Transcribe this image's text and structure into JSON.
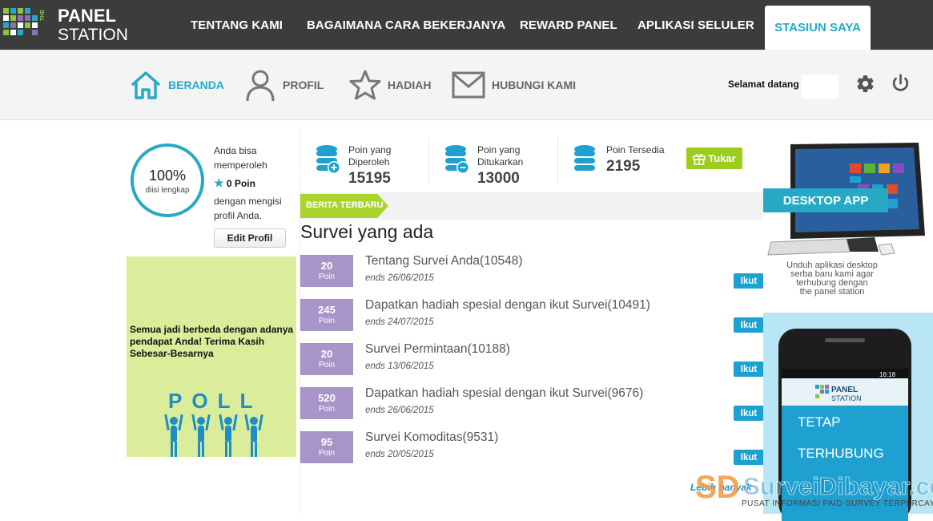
{
  "logo": {
    "the": "THE",
    "panel": "PANEL",
    "station": "STATION"
  },
  "topnav": {
    "items": [
      {
        "label": "TENTANG KAMI"
      },
      {
        "label": "BAGAIMANA CARA BEKERJANYA"
      },
      {
        "label": "REWARD PANEL"
      },
      {
        "label": "APLIKASI SELULER"
      }
    ],
    "active": "STASIUN SAYA"
  },
  "subnav": {
    "items": [
      {
        "label": "BERANDA",
        "icon": "home-icon"
      },
      {
        "label": "PROFIL",
        "icon": "user-icon"
      },
      {
        "label": "HADIAH",
        "icon": "star-icon"
      },
      {
        "label": "HUBUNGI KAMI",
        "icon": "mail-icon"
      }
    ],
    "welcome": "Selamat datang"
  },
  "profile": {
    "percent": "100%",
    "percent_caption": "diisi lengkap",
    "line1": "Anda bisa",
    "line2": "memperoleh",
    "points": "0 Poin",
    "line3": "dengan mengisi",
    "line4": "profil Anda.",
    "edit_button": "Edit Profil",
    "completion": 1.0
  },
  "poll": {
    "text": "Semua jadi berbeda dengan adanya pendapat Anda! Terima Kasih Sebesar-Besarnya",
    "word": "POLL"
  },
  "stats": [
    {
      "label_1": "Poin yang",
      "label_2": "Diperoleh",
      "value": "15195"
    },
    {
      "label_1": "Poin yang",
      "label_2": "Ditukarkan",
      "value": "13000"
    },
    {
      "label_1": "Poin Tersedia",
      "label_2": "",
      "value": "2195"
    }
  ],
  "tukar_button": "Tukar",
  "news_tag": "BERITA TERBARU",
  "survey_heading": "Survei yang ada",
  "surveys": [
    {
      "points": "20",
      "unit": "Poin",
      "title": "Tentang Survei Anda(10548)",
      "ends": "ends 26/06/2015",
      "action": "Ikut"
    },
    {
      "points": "245",
      "unit": "Poin",
      "title": "Dapatkan hadiah spesial dengan ikut Survei(10491)",
      "ends": "ends 24/07/2015",
      "action": "Ikut"
    },
    {
      "points": "20",
      "unit": "Poin",
      "title": "Survei Permintaan(10188)",
      "ends": "ends 13/06/2015",
      "action": "Ikut"
    },
    {
      "points": "520",
      "unit": "Poin",
      "title": "Dapatkan hadiah spesial dengan ikut Survei(9676)",
      "ends": "ends 26/06/2015",
      "action": "Ikut"
    },
    {
      "points": "95",
      "unit": "Poin",
      "title": "Survei Komoditas(9531)",
      "ends": "ends 20/05/2015",
      "action": "Ikut"
    }
  ],
  "more_link": "Lebih banyak",
  "ads": {
    "desktop_label": "DESKTOP APP",
    "desktop_caption_1": "Unduh aplikasi desktop",
    "desktop_caption_2": "serba baru kami agar",
    "desktop_caption_3": "terhubung dengan",
    "desktop_caption_4": "the panel station",
    "phone_time": "16:18",
    "phone_logo_1": "PANEL",
    "phone_logo_2": "STATION",
    "mobile_line1": "TETAP",
    "mobile_line2": "TERHUBUNG"
  },
  "watermark": {
    "brand": "SurveiDibayar.com",
    "tagline": "PUSAT INFORMASI PAID-SURVEY TERPERCAYA"
  },
  "colors": {
    "topbar": "#3c3c3c",
    "accent": "#27a9c6",
    "survey_box": "#a895c8",
    "ikut_button": "#1ea1d0",
    "tukar_button": "#9ccd1e",
    "news_tag": "#a9d42b",
    "poll_bg": "#dbec9a"
  }
}
